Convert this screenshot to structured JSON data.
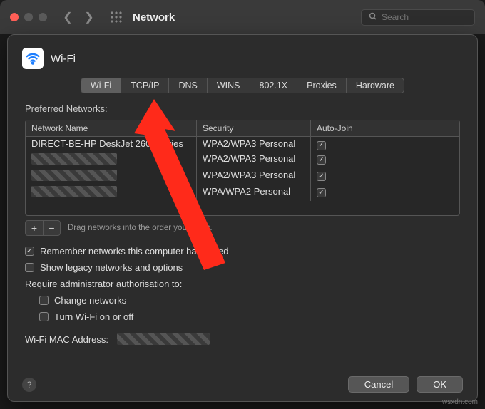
{
  "window": {
    "title": "Network",
    "search_placeholder": "Search"
  },
  "sheet": {
    "title": "Wi-Fi",
    "tabs": [
      "Wi-Fi",
      "TCP/IP",
      "DNS",
      "WINS",
      "802.1X",
      "Proxies",
      "Hardware"
    ],
    "active_tab": "Wi-Fi",
    "section_label": "Preferred Networks:",
    "columns": {
      "name": "Network Name",
      "security": "Security",
      "auto": "Auto-Join"
    },
    "rows": [
      {
        "name": "DIRECT-BE-HP DeskJet 2600 series",
        "security": "WPA2/WPA3 Personal",
        "auto": true,
        "redacted": false
      },
      {
        "name": "",
        "security": "WPA2/WPA3 Personal",
        "auto": true,
        "redacted": true
      },
      {
        "name": "",
        "security": "WPA2/WPA3 Personal",
        "auto": true,
        "redacted": true
      },
      {
        "name": "",
        "security": "WPA/WPA2 Personal",
        "auto": true,
        "redacted": true
      }
    ],
    "drag_hint": "Drag networks into the order you prefer.",
    "options": {
      "remember": {
        "label": "Remember networks this computer has joined",
        "checked": true
      },
      "legacy": {
        "label": "Show legacy networks and options",
        "checked": false
      },
      "require_label": "Require administrator authorisation to:",
      "change": {
        "label": "Change networks",
        "checked": false
      },
      "toggle": {
        "label": "Turn Wi-Fi on or off",
        "checked": false
      }
    },
    "mac_label": "Wi-Fi MAC Address:",
    "buttons": {
      "cancel": "Cancel",
      "ok": "OK"
    }
  },
  "watermark": "wsxdn.com"
}
